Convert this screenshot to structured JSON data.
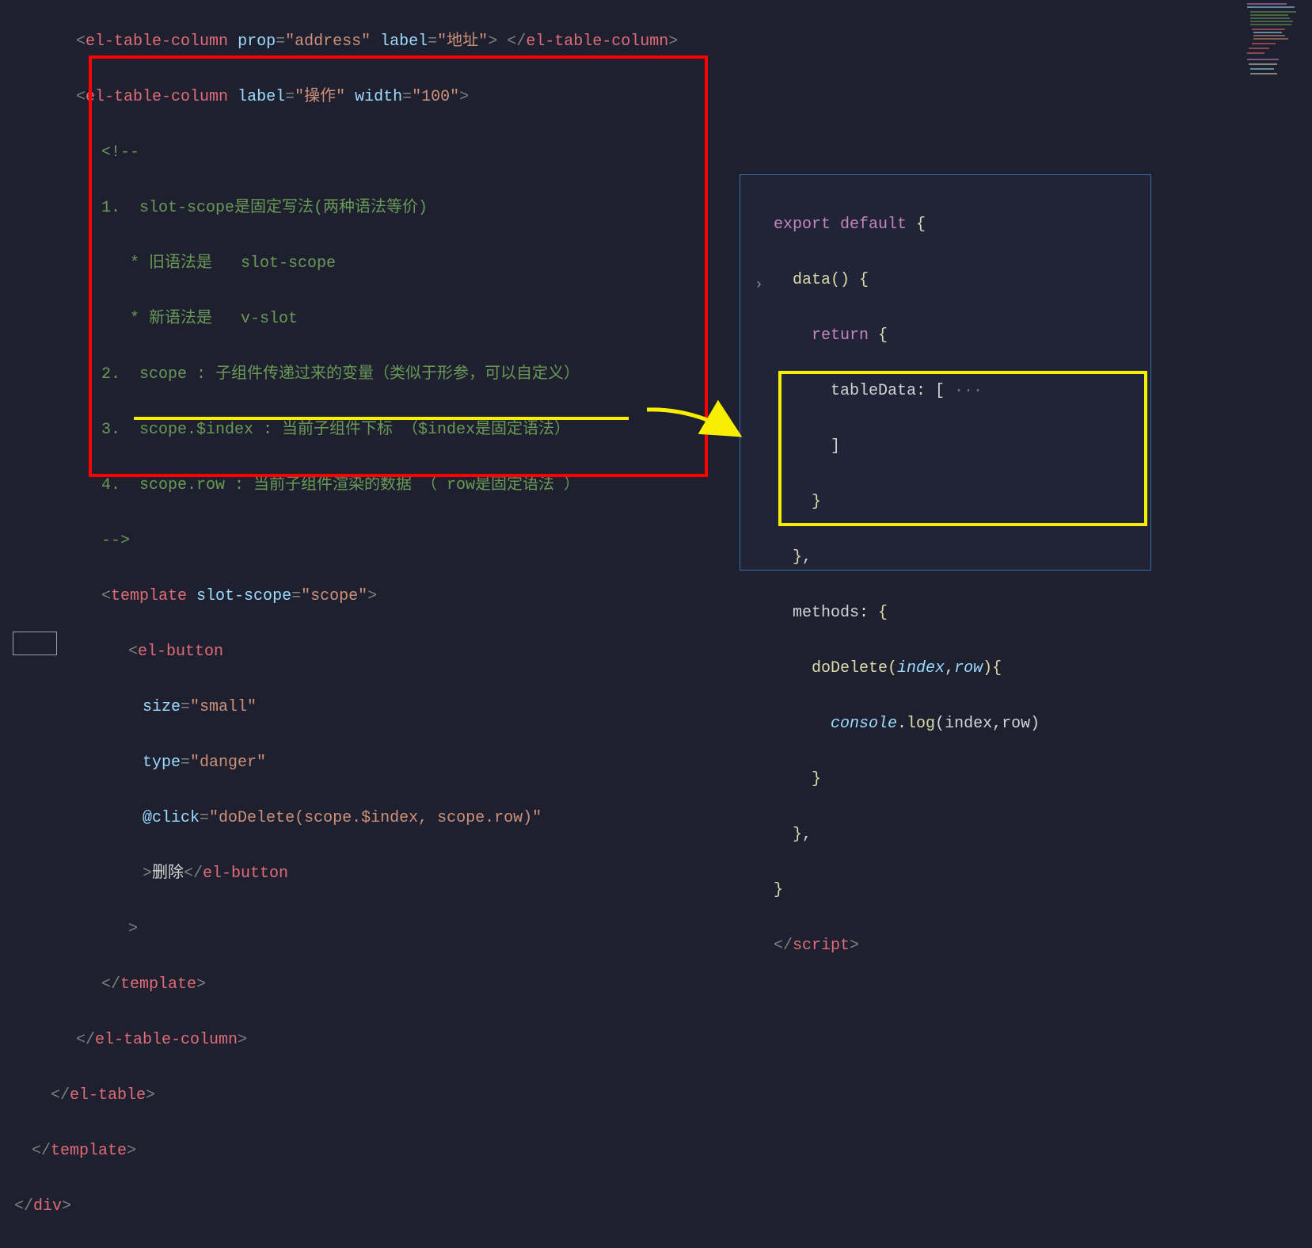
{
  "left": {
    "l01_a": "<",
    "l01_tag": "el-table-column",
    "l01_sp": " ",
    "l01_attr1": "prop",
    "l01_eq": "=",
    "l01_val1": "\"address\"",
    "l01_sp2": " ",
    "l01_attr2": "label",
    "l01_val2": "\"地址\"",
    "l01_b": ">",
    "l01_sp3": " ",
    "l01_c": "</",
    "l01_d": ">",
    "l02_a": "<",
    "l02_tag": "el-table-column",
    "l02_sp": " ",
    "l02_attr1": "label",
    "l02_eq": "=",
    "l02_val1": "\"操作\"",
    "l02_sp2": " ",
    "l02_attr2": "width",
    "l02_val2": "\"100\"",
    "l02_b": ">",
    "l03": "<!--",
    "l04": "1.  slot-scope是固定写法(两种语法等价)",
    "l05": "   * 旧语法是   slot-scope",
    "l06": "   * 新语法是   v-slot",
    "l07": "2.  scope : 子组件传递过来的变量（类似于形参，可以自定义）",
    "l08": "3.  scope.$index : 当前子组件下标 （$index是固定语法）",
    "l09": "4.  scope.row : 当前子组件渲染的数据 （ row是固定语法 ）",
    "l10": "-->",
    "l11_a": "<",
    "l11_tag": "template",
    "l11_sp": " ",
    "l11_attr": "slot-scope",
    "l11_eq": "=",
    "l11_val": "\"scope\"",
    "l11_b": ">",
    "l12_a": "<",
    "l12_tag": "el-button",
    "l13_attr": "size",
    "l13_eq": "=",
    "l13_val": "\"small\"",
    "l14_attr": "type",
    "l14_eq": "=",
    "l14_val": "\"danger\"",
    "l15_at": "@",
    "l15_attr": "click",
    "l15_eq": "=",
    "l15_val": "\"doDelete(scope.$index, scope.row)\"",
    "l16_a": ">",
    "l16_txt": "删除",
    "l16_b": "</",
    "l16_tag": "el-button",
    "l17": ">",
    "l18_a": "</",
    "l18_tag": "template",
    "l18_b": ">",
    "l19_a": "</",
    "l19_tag": "el-table-column",
    "l19_b": ">",
    "l20_a": "</",
    "l20_tag": "el-table",
    "l20_b": ">",
    "l21_a": "</",
    "l21_tag": "template",
    "l21_b": ">",
    "l22_a": "</",
    "l22_tag": "div",
    "l22_b": ">"
  },
  "right": {
    "r01_kw": "export default",
    "r01_b": " {",
    "r02_fn": "data",
    "r02_p": "() {",
    "r03_kw": "return",
    "r03_b": " {",
    "r04_var": "tableData",
    "r04_c": ": [",
    "r04_el": " ···",
    "r05": "]",
    "r06": "}",
    "r07": "}",
    "r07b": ",",
    "r08_var": "methods",
    "r08_c": ": {",
    "r09_fn": "doDelete",
    "r09_p1": "(",
    "r09_a1": "index",
    "r09_cm": ",",
    "r09_a2": "row",
    "r09_p2": "){",
    "r10_c": "console",
    "r10_d": ".",
    "r10_l": "log",
    "r10_p1": "(",
    "r10_a1": "index",
    "r10_cm": ",",
    "r10_a2": "row",
    "r10_p2": ")",
    "r11": "}",
    "r12": "}",
    "r12b": ",",
    "r13": "}",
    "r14_a": "</",
    "r14_tag": "script",
    "r14_b": ">"
  }
}
